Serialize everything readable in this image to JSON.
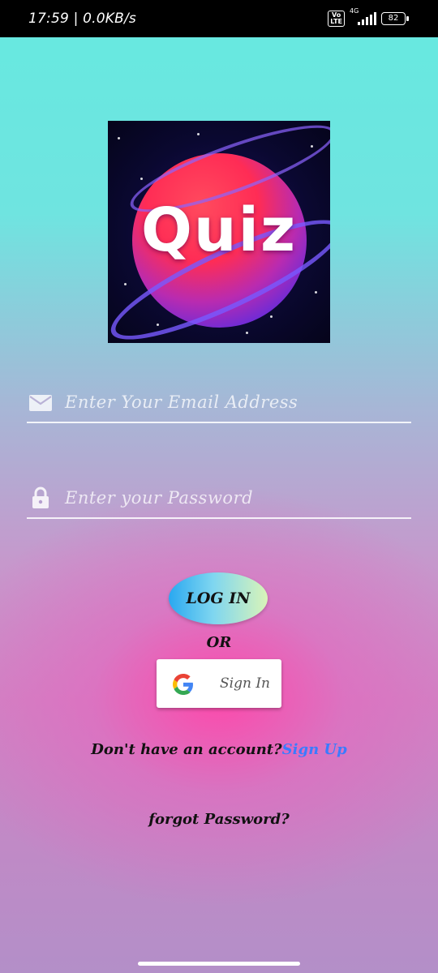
{
  "status_bar": {
    "time": "17:59 | 0.0KB/s",
    "network": "4G",
    "volte": "Vo LTE",
    "battery": "82"
  },
  "logo": {
    "text": "Quiz"
  },
  "login_form": {
    "email_placeholder": "Enter Your Email Address",
    "password_placeholder": "Enter your Password",
    "email_icon": "mail-icon",
    "password_icon": "lock-icon"
  },
  "actions": {
    "login_label": "LOG IN",
    "or_label": "OR",
    "google_label": "Sign In",
    "google_icon": "google-icon",
    "signup_prompt": "Don't have an account?",
    "signup_link": "Sign Up",
    "forgot_label": "forgot Password?"
  },
  "colors": {
    "top_bg": "#66e9e0",
    "bottom_bg": "#ff46aa",
    "link": "#3b7bff"
  }
}
